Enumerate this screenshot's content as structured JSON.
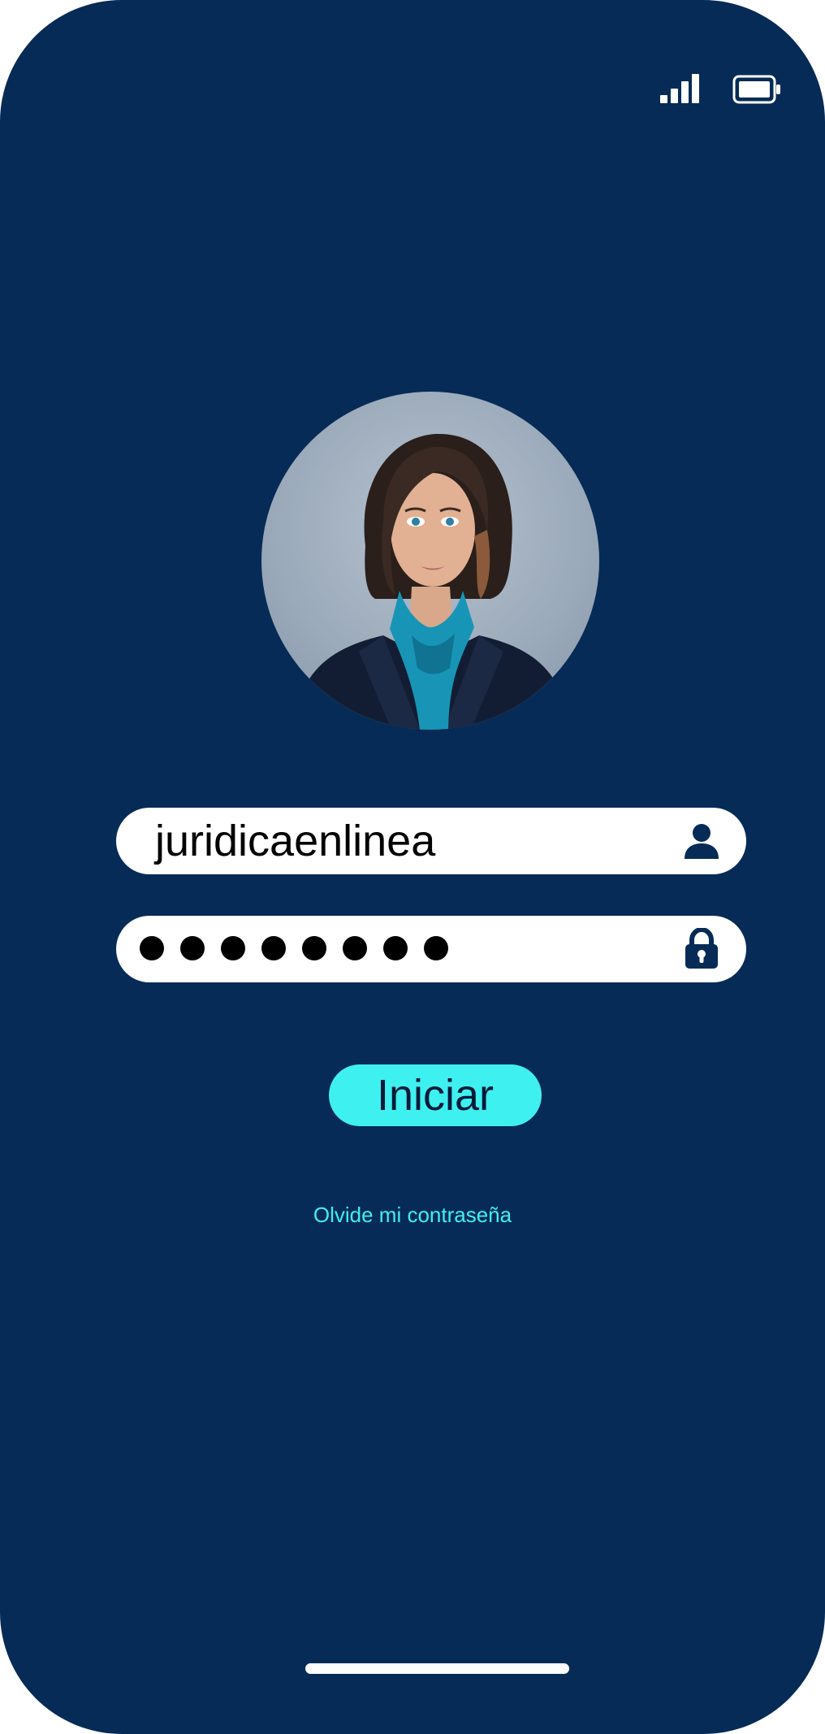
{
  "status_bar": {
    "signal_icon": "signal-icon",
    "battery_icon": "battery-icon"
  },
  "avatar": {
    "icon": "profile-photo"
  },
  "login": {
    "username_value": "juridicaenlinea",
    "username_icon": "user-icon",
    "password_dot_count": 8,
    "password_icon": "lock-icon",
    "submit_label": "Iniciar",
    "forgot_label": "Olvide mi contraseña"
  },
  "colors": {
    "background": "#062b56",
    "accent": "#3ff0f0",
    "field": "#ffffff"
  }
}
